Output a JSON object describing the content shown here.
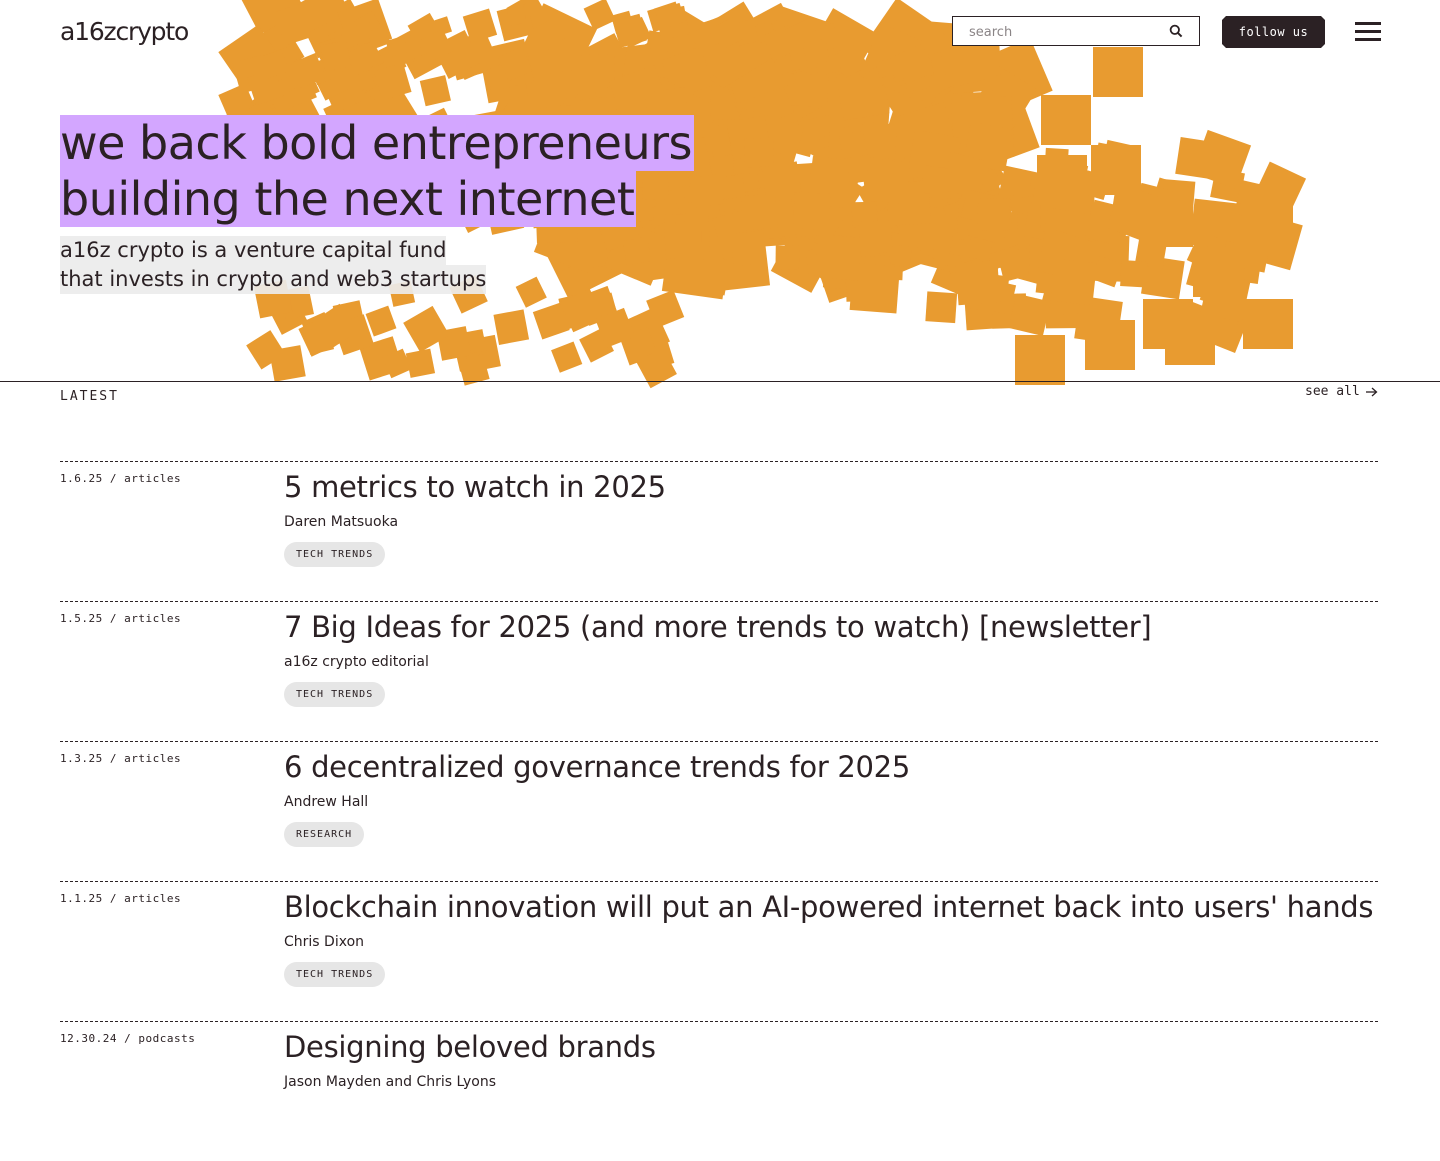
{
  "header": {
    "logo": "a16zcrypto",
    "search_placeholder": "search",
    "follow_label": "follow us"
  },
  "hero": {
    "headline_line1": "we back bold entrepreneurs",
    "headline_line2": "building the next internet",
    "sub_line1": "a16z crypto is a venture capital fund",
    "sub_line2": "that invests in crypto and web3 startups"
  },
  "latest": {
    "label": "LATEST",
    "see_all": "see all",
    "items": [
      {
        "meta": "1.6.25 / articles",
        "title": "5 metrics to watch in 2025",
        "author": "Daren Matsuoka",
        "tag": "TECH TRENDS"
      },
      {
        "meta": "1.5.25 / articles",
        "title": "7 Big Ideas for 2025 (and more trends to watch) [newsletter]",
        "author": "a16z crypto editorial",
        "tag": "TECH TRENDS"
      },
      {
        "meta": "1.3.25 / articles",
        "title": "6 decentralized governance trends for 2025",
        "author": "Andrew Hall",
        "tag": "RESEARCH"
      },
      {
        "meta": "1.1.25 / articles",
        "title": "Blockchain innovation will put an AI-powered internet back into users' hands",
        "author": "Chris Dixon",
        "tag": "TECH TRENDS"
      },
      {
        "meta": "12.30.24 / podcasts",
        "title": "Designing beloved brands",
        "author": "Jason Mayden and Chris Lyons",
        "tag": ""
      }
    ]
  },
  "colors": {
    "accent_orange": "#e89b30",
    "highlight_purple": "#d3a6ff",
    "text_dark": "#2b2124"
  },
  "icons": {
    "search": "magnifier",
    "menu": "hamburger",
    "see_all": "arrow-right"
  }
}
